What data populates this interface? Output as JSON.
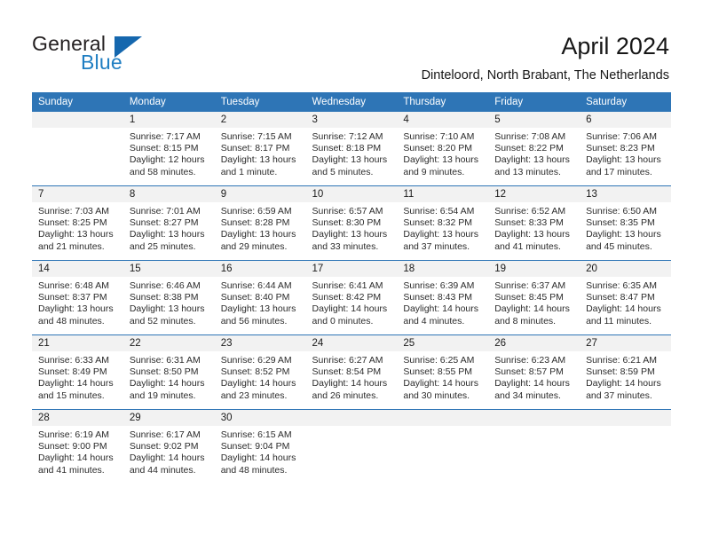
{
  "brand": {
    "name_part1": "General",
    "name_part2": "Blue",
    "accent_color": "#1f7ec2",
    "flag_color": "#1567ae"
  },
  "header": {
    "title": "April 2024",
    "subtitle": "Dinteloord, North Brabant, The Netherlands"
  },
  "calendar": {
    "header_bg": "#2e75b6",
    "weekday_headers": [
      "Sunday",
      "Monday",
      "Tuesday",
      "Wednesday",
      "Thursday",
      "Friday",
      "Saturday"
    ],
    "weeks": [
      [
        {
          "day": "",
          "sunrise": "",
          "sunset": "",
          "daylight_line1": "",
          "daylight_line2": ""
        },
        {
          "day": "1",
          "sunrise": "Sunrise: 7:17 AM",
          "sunset": "Sunset: 8:15 PM",
          "daylight_line1": "Daylight: 12 hours",
          "daylight_line2": "and 58 minutes."
        },
        {
          "day": "2",
          "sunrise": "Sunrise: 7:15 AM",
          "sunset": "Sunset: 8:17 PM",
          "daylight_line1": "Daylight: 13 hours",
          "daylight_line2": "and 1 minute."
        },
        {
          "day": "3",
          "sunrise": "Sunrise: 7:12 AM",
          "sunset": "Sunset: 8:18 PM",
          "daylight_line1": "Daylight: 13 hours",
          "daylight_line2": "and 5 minutes."
        },
        {
          "day": "4",
          "sunrise": "Sunrise: 7:10 AM",
          "sunset": "Sunset: 8:20 PM",
          "daylight_line1": "Daylight: 13 hours",
          "daylight_line2": "and 9 minutes."
        },
        {
          "day": "5",
          "sunrise": "Sunrise: 7:08 AM",
          "sunset": "Sunset: 8:22 PM",
          "daylight_line1": "Daylight: 13 hours",
          "daylight_line2": "and 13 minutes."
        },
        {
          "day": "6",
          "sunrise": "Sunrise: 7:06 AM",
          "sunset": "Sunset: 8:23 PM",
          "daylight_line1": "Daylight: 13 hours",
          "daylight_line2": "and 17 minutes."
        }
      ],
      [
        {
          "day": "7",
          "sunrise": "Sunrise: 7:03 AM",
          "sunset": "Sunset: 8:25 PM",
          "daylight_line1": "Daylight: 13 hours",
          "daylight_line2": "and 21 minutes."
        },
        {
          "day": "8",
          "sunrise": "Sunrise: 7:01 AM",
          "sunset": "Sunset: 8:27 PM",
          "daylight_line1": "Daylight: 13 hours",
          "daylight_line2": "and 25 minutes."
        },
        {
          "day": "9",
          "sunrise": "Sunrise: 6:59 AM",
          "sunset": "Sunset: 8:28 PM",
          "daylight_line1": "Daylight: 13 hours",
          "daylight_line2": "and 29 minutes."
        },
        {
          "day": "10",
          "sunrise": "Sunrise: 6:57 AM",
          "sunset": "Sunset: 8:30 PM",
          "daylight_line1": "Daylight: 13 hours",
          "daylight_line2": "and 33 minutes."
        },
        {
          "day": "11",
          "sunrise": "Sunrise: 6:54 AM",
          "sunset": "Sunset: 8:32 PM",
          "daylight_line1": "Daylight: 13 hours",
          "daylight_line2": "and 37 minutes."
        },
        {
          "day": "12",
          "sunrise": "Sunrise: 6:52 AM",
          "sunset": "Sunset: 8:33 PM",
          "daylight_line1": "Daylight: 13 hours",
          "daylight_line2": "and 41 minutes."
        },
        {
          "day": "13",
          "sunrise": "Sunrise: 6:50 AM",
          "sunset": "Sunset: 8:35 PM",
          "daylight_line1": "Daylight: 13 hours",
          "daylight_line2": "and 45 minutes."
        }
      ],
      [
        {
          "day": "14",
          "sunrise": "Sunrise: 6:48 AM",
          "sunset": "Sunset: 8:37 PM",
          "daylight_line1": "Daylight: 13 hours",
          "daylight_line2": "and 48 minutes."
        },
        {
          "day": "15",
          "sunrise": "Sunrise: 6:46 AM",
          "sunset": "Sunset: 8:38 PM",
          "daylight_line1": "Daylight: 13 hours",
          "daylight_line2": "and 52 minutes."
        },
        {
          "day": "16",
          "sunrise": "Sunrise: 6:44 AM",
          "sunset": "Sunset: 8:40 PM",
          "daylight_line1": "Daylight: 13 hours",
          "daylight_line2": "and 56 minutes."
        },
        {
          "day": "17",
          "sunrise": "Sunrise: 6:41 AM",
          "sunset": "Sunset: 8:42 PM",
          "daylight_line1": "Daylight: 14 hours",
          "daylight_line2": "and 0 minutes."
        },
        {
          "day": "18",
          "sunrise": "Sunrise: 6:39 AM",
          "sunset": "Sunset: 8:43 PM",
          "daylight_line1": "Daylight: 14 hours",
          "daylight_line2": "and 4 minutes."
        },
        {
          "day": "19",
          "sunrise": "Sunrise: 6:37 AM",
          "sunset": "Sunset: 8:45 PM",
          "daylight_line1": "Daylight: 14 hours",
          "daylight_line2": "and 8 minutes."
        },
        {
          "day": "20",
          "sunrise": "Sunrise: 6:35 AM",
          "sunset": "Sunset: 8:47 PM",
          "daylight_line1": "Daylight: 14 hours",
          "daylight_line2": "and 11 minutes."
        }
      ],
      [
        {
          "day": "21",
          "sunrise": "Sunrise: 6:33 AM",
          "sunset": "Sunset: 8:49 PM",
          "daylight_line1": "Daylight: 14 hours",
          "daylight_line2": "and 15 minutes."
        },
        {
          "day": "22",
          "sunrise": "Sunrise: 6:31 AM",
          "sunset": "Sunset: 8:50 PM",
          "daylight_line1": "Daylight: 14 hours",
          "daylight_line2": "and 19 minutes."
        },
        {
          "day": "23",
          "sunrise": "Sunrise: 6:29 AM",
          "sunset": "Sunset: 8:52 PM",
          "daylight_line1": "Daylight: 14 hours",
          "daylight_line2": "and 23 minutes."
        },
        {
          "day": "24",
          "sunrise": "Sunrise: 6:27 AM",
          "sunset": "Sunset: 8:54 PM",
          "daylight_line1": "Daylight: 14 hours",
          "daylight_line2": "and 26 minutes."
        },
        {
          "day": "25",
          "sunrise": "Sunrise: 6:25 AM",
          "sunset": "Sunset: 8:55 PM",
          "daylight_line1": "Daylight: 14 hours",
          "daylight_line2": "and 30 minutes."
        },
        {
          "day": "26",
          "sunrise": "Sunrise: 6:23 AM",
          "sunset": "Sunset: 8:57 PM",
          "daylight_line1": "Daylight: 14 hours",
          "daylight_line2": "and 34 minutes."
        },
        {
          "day": "27",
          "sunrise": "Sunrise: 6:21 AM",
          "sunset": "Sunset: 8:59 PM",
          "daylight_line1": "Daylight: 14 hours",
          "daylight_line2": "and 37 minutes."
        }
      ],
      [
        {
          "day": "28",
          "sunrise": "Sunrise: 6:19 AM",
          "sunset": "Sunset: 9:00 PM",
          "daylight_line1": "Daylight: 14 hours",
          "daylight_line2": "and 41 minutes."
        },
        {
          "day": "29",
          "sunrise": "Sunrise: 6:17 AM",
          "sunset": "Sunset: 9:02 PM",
          "daylight_line1": "Daylight: 14 hours",
          "daylight_line2": "and 44 minutes."
        },
        {
          "day": "30",
          "sunrise": "Sunrise: 6:15 AM",
          "sunset": "Sunset: 9:04 PM",
          "daylight_line1": "Daylight: 14 hours",
          "daylight_line2": "and 48 minutes."
        },
        {
          "day": "",
          "sunrise": "",
          "sunset": "",
          "daylight_line1": "",
          "daylight_line2": ""
        },
        {
          "day": "",
          "sunrise": "",
          "sunset": "",
          "daylight_line1": "",
          "daylight_line2": ""
        },
        {
          "day": "",
          "sunrise": "",
          "sunset": "",
          "daylight_line1": "",
          "daylight_line2": ""
        },
        {
          "day": "",
          "sunrise": "",
          "sunset": "",
          "daylight_line1": "",
          "daylight_line2": ""
        }
      ]
    ]
  }
}
